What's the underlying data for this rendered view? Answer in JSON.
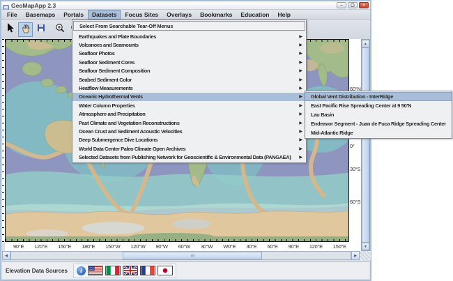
{
  "window": {
    "title": "GeoMapApp 2.3"
  },
  "icons": {
    "minimize": "–",
    "maximize": "▢",
    "close": "×",
    "submenu_arrow": "▶",
    "info": "i",
    "scroll_left": "◀",
    "scroll_right": "▶",
    "scroll_up": "▲",
    "scroll_down": "▼"
  },
  "menu_bar": {
    "items": [
      {
        "label": "File"
      },
      {
        "label": "Basemaps"
      },
      {
        "label": "Portals"
      },
      {
        "label": "Datasets",
        "highlighted": true
      },
      {
        "label": "Focus Sites"
      },
      {
        "label": "Overlays"
      },
      {
        "label": "Bookmarks"
      },
      {
        "label": "Education"
      },
      {
        "label": "Help"
      }
    ]
  },
  "toolbar": {
    "tools": [
      "select-cursor",
      "pan-hand",
      "save",
      "zoom-in",
      "zoom-out",
      "profile-tool"
    ],
    "active_tool": "pan-hand"
  },
  "datasets_menu": {
    "tear_off": "Select From Searchable Tear-Off Menus",
    "items": [
      {
        "label": "Earthquakes and Plate Boundaries"
      },
      {
        "label": "Volcanoes and Seamounts"
      },
      {
        "label": "Seafloor Photos"
      },
      {
        "label": "Seafloor Sediment Cores"
      },
      {
        "label": "Seafloor Sediment Composition"
      },
      {
        "label": "Seabed Sediment Color"
      },
      {
        "label": "Heatflow Measurements"
      },
      {
        "label": "Oceanic Hydrothermal Vents",
        "highlighted": true
      },
      {
        "label": "Water Column Properties"
      },
      {
        "label": "Atmosphere and Precipitation"
      },
      {
        "label": "Past Climate and Vegetation Reconstructions"
      },
      {
        "label": "Ocean Crust and Sediment Acoustic Velocities"
      },
      {
        "label": "Deep Submergence Dive Locations"
      },
      {
        "label": "World Data Center Paleo Climate Open Archives"
      },
      {
        "label": "Selected Datasets from Publishing Network for Geoscientific & Environmental Data (PANGAEA)"
      }
    ]
  },
  "vents_submenu": {
    "items": [
      {
        "label": "Global Vent Distribution - InterRidge",
        "highlighted": true
      },
      {
        "label": "East Pacific Rise Spreading Center at 9 50'N"
      },
      {
        "label": "Lau Basin"
      },
      {
        "label": "Endeavor Segment - Juan de Fuca Ridge Spreading Center"
      },
      {
        "label": "Mid-Atlantic Ridge"
      }
    ]
  },
  "map": {
    "lat_labels": [
      "60°N",
      "0°",
      "30°S",
      "60°S"
    ],
    "lon_labels": [
      "90°E",
      "120°E",
      "150°E",
      "180°E",
      "150°W",
      "120°W",
      "90°W",
      "60°W",
      "30°W",
      "W0°E",
      "30°E",
      "60°E",
      "90°E",
      "120°E",
      "150°E"
    ]
  },
  "status_bar": {
    "label": "Elevation Data Sources",
    "flags": [
      "usa",
      "italy",
      "uk",
      "france",
      "japan"
    ]
  },
  "colors": {
    "menu_highlight": "#a9bed9",
    "chrome": "#dce1e8",
    "window_border": "#a6c0da",
    "ocean_deep": "#8e95bf",
    "ocean_mid": "#7fc2c3",
    "land_green": "#a3bb8a",
    "land_tan": "#d8c195",
    "antarctica": "#e0c79e",
    "close_button": "#c04530"
  }
}
